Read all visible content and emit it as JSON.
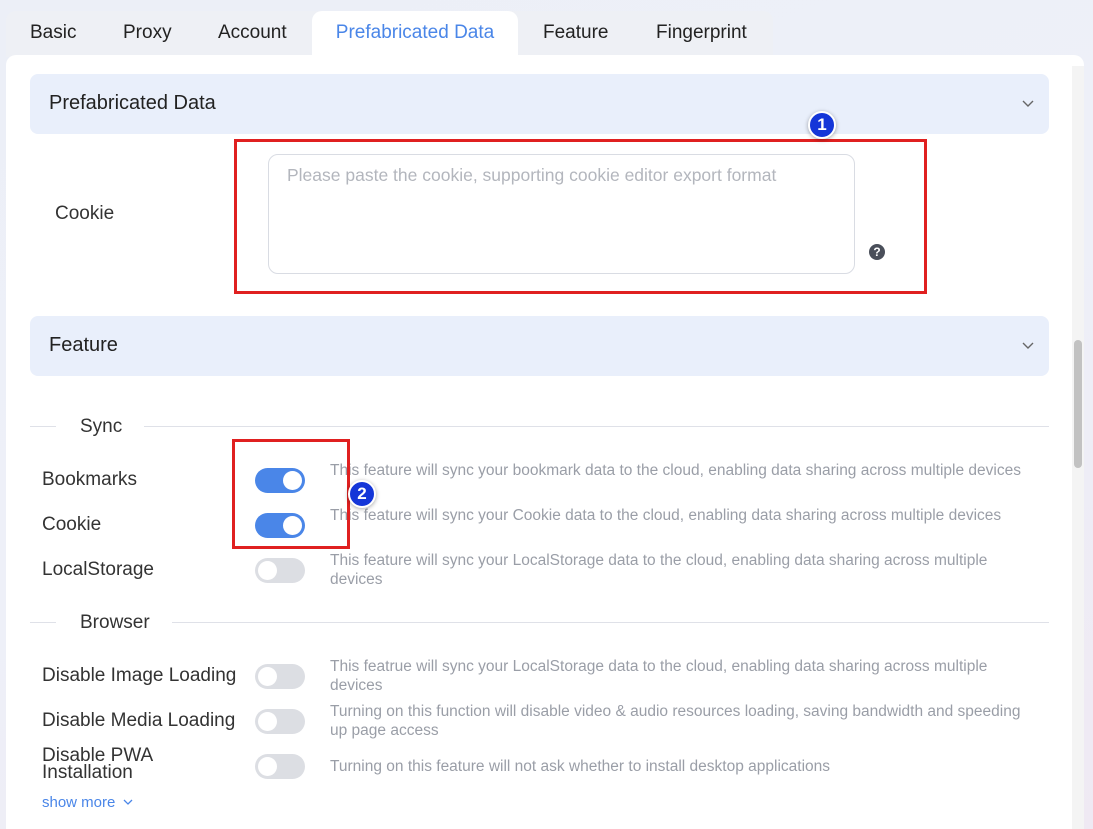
{
  "tabs": [
    {
      "label": "Basic"
    },
    {
      "label": "Proxy"
    },
    {
      "label": "Account"
    },
    {
      "label": "Prefabricated Data"
    },
    {
      "label": "Feature"
    },
    {
      "label": "Fingerprint"
    }
  ],
  "active_tab": "Prefabricated Data",
  "prefab_section": {
    "title": "Prefabricated Data",
    "cookie_label": "Cookie",
    "cookie_placeholder": "Please paste the cookie, supporting cookie editor export format",
    "cookie_value": "",
    "help_icon": "question-circle-icon"
  },
  "feature_section": {
    "title": "Feature",
    "sync_group": {
      "label": "Sync",
      "items": [
        {
          "label": "Bookmarks",
          "enabled": true,
          "desc": "This feature will sync your bookmark data to the cloud, enabling data sharing across multiple devices"
        },
        {
          "label": "Cookie",
          "enabled": true,
          "desc": "This feature will sync your Cookie data to the cloud, enabling data sharing across multiple devices"
        },
        {
          "label": "LocalStorage",
          "enabled": false,
          "desc": "This feature will sync your LocalStorage data to the cloud, enabling data sharing across multiple devices"
        }
      ]
    },
    "browser_group": {
      "label": "Browser",
      "items": [
        {
          "label": "Disable Image Loading",
          "enabled": false,
          "desc": "This featrue will sync your LocalStorage data to the cloud, enabling data sharing across multiple devices"
        },
        {
          "label": "Disable Media Loading",
          "enabled": false,
          "desc": "Turning on this function will disable video & audio resources loading, saving bandwidth and speeding up page access"
        },
        {
          "label": "Disable PWA Installation",
          "enabled": false,
          "desc": "Turning on this feature will not ask whether to install desktop applications"
        }
      ]
    },
    "show_more": "show more"
  },
  "annotations": {
    "badge1": "1",
    "badge2": "2"
  },
  "colors": {
    "accent": "#4a86e8",
    "highlight_box": "#e02020",
    "badge": "#1436d8"
  }
}
